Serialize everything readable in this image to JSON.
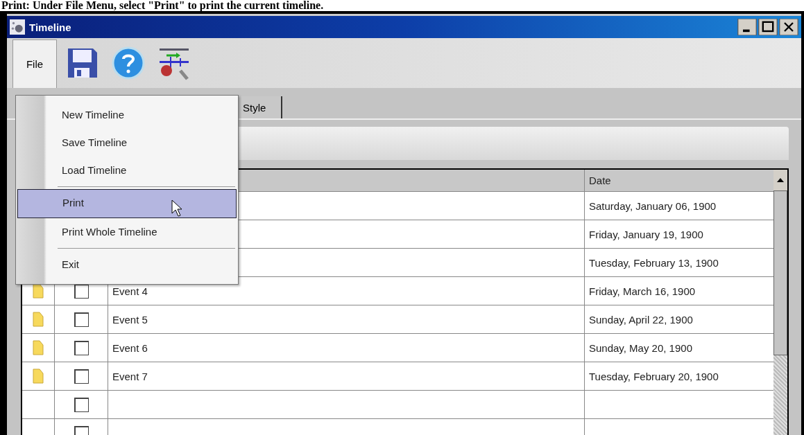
{
  "caption": "Print: Under File Menu, select \"Print\" to print the current timeline.",
  "window": {
    "title": "Timeline"
  },
  "toolbar": {
    "menu_label": "File",
    "menu_open": true
  },
  "tabs": [
    {
      "label": "Style",
      "selected": false
    }
  ],
  "menu": [
    {
      "kind": "item",
      "label": "New Timeline",
      "selected": false
    },
    {
      "kind": "item",
      "label": "Save Timeline",
      "selected": false
    },
    {
      "kind": "item",
      "label": "Load Timeline",
      "selected": false
    },
    {
      "kind": "separator"
    },
    {
      "kind": "item",
      "label": "Print",
      "selected": true
    },
    {
      "kind": "item",
      "label": "Print Whole Timeline",
      "selected": false
    },
    {
      "kind": "separator"
    },
    {
      "kind": "item",
      "label": "Exit",
      "selected": false
    }
  ],
  "table": {
    "date_header": "Date",
    "rows": [
      {
        "date": "Saturday, January 06, 1900"
      },
      {
        "date": "Friday, January 19, 1900"
      },
      {
        "date": "Tuesday, February 13, 1900"
      },
      {
        "note": true,
        "checked": false,
        "name": "Event 4",
        "date": "Friday, March 16, 1900"
      },
      {
        "note": true,
        "checked": false,
        "name": "Event 5",
        "date": "Sunday, April 22, 1900"
      },
      {
        "note": true,
        "checked": false,
        "name": "Event 6",
        "date": "Sunday, May 20, 1900"
      },
      {
        "note": true,
        "checked": false,
        "name": "Event 7",
        "date": "Tuesday, February 20, 1900"
      },
      {
        "note": false,
        "checked": false
      },
      {
        "note": false,
        "checked": false
      }
    ]
  }
}
